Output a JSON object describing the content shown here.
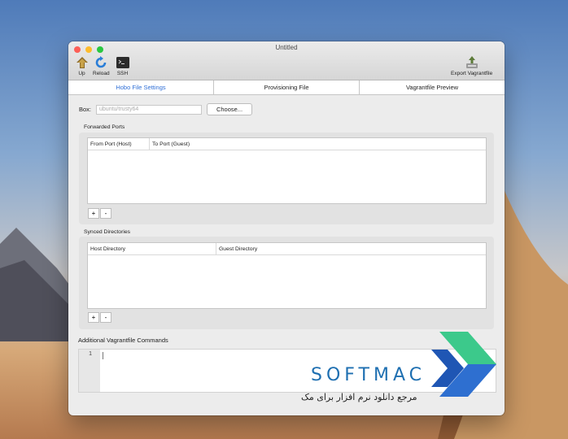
{
  "window": {
    "title": "Untitled"
  },
  "toolbar": {
    "up_label": "Up",
    "reload_label": "Reload",
    "ssh_label": "SSH",
    "export_label": "Export Vagrantfile"
  },
  "tabs": [
    {
      "label": "Hobo File Settings",
      "active": true
    },
    {
      "label": "Provisioning File",
      "active": false
    },
    {
      "label": "Vagrantfile Preview",
      "active": false
    }
  ],
  "box": {
    "label": "Box:",
    "placeholder": "ubuntu/trusty64",
    "choose_label": "Choose..."
  },
  "forwarded_ports": {
    "title": "Forwarded Ports",
    "columns": [
      "From Port (Host)",
      "To Port (Guest)"
    ],
    "add": "+",
    "remove": "-"
  },
  "synced_directories": {
    "title": "Synced Directories",
    "columns": [
      "Host Directory",
      "Guest Directory"
    ],
    "add": "+",
    "remove": "-"
  },
  "additional_commands": {
    "title": "Additional Vagrantfile Commands",
    "line_number": "1"
  },
  "watermark": {
    "brand": "SOFTMAC",
    "subtitle": "مرجع دانلود نرم افزار برای مک"
  },
  "colors": {
    "accent": "#2f6fd6",
    "brand": "#1e6fb1",
    "brand_green": "#3cc98b"
  }
}
